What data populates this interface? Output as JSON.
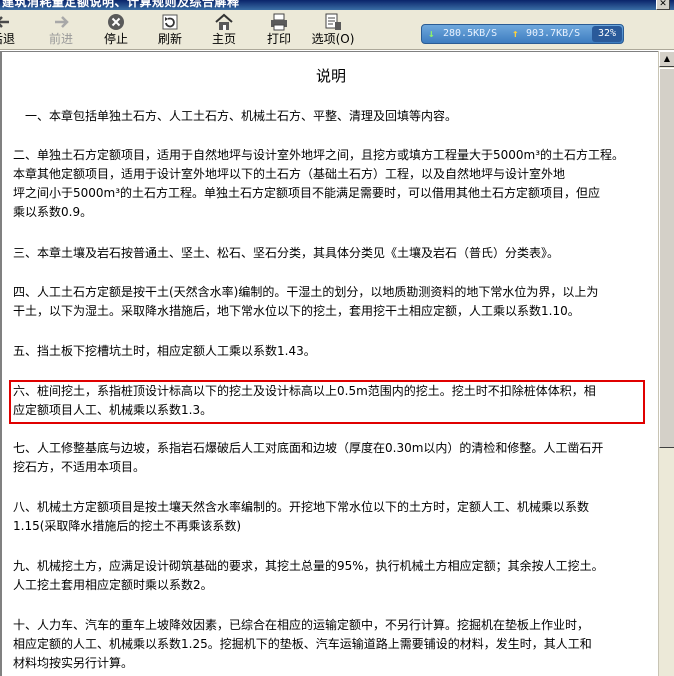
{
  "window": {
    "title": "建筑消耗量定额说明、计算规则及综合解释"
  },
  "toolbar": {
    "buttons": [
      {
        "id": "back",
        "label": "后退",
        "icon": "back-arrow-icon"
      },
      {
        "id": "forward",
        "label": "前进",
        "icon": "forward-arrow-icon"
      },
      {
        "id": "stop",
        "label": "停止",
        "icon": "stop-icon"
      },
      {
        "id": "refresh",
        "label": "刷新",
        "icon": "refresh-icon"
      },
      {
        "id": "home",
        "label": "主页",
        "icon": "home-icon"
      },
      {
        "id": "print",
        "label": "打印",
        "icon": "print-icon"
      },
      {
        "id": "options",
        "label": "选项(O)",
        "icon": "options-icon"
      }
    ]
  },
  "network": {
    "download": "280.5KB/S",
    "upload": "903.7KB/S",
    "percent": "32%",
    "colors": {
      "download_arrow": "#8ef06a",
      "upload_arrow": "#ffd23a"
    }
  },
  "document": {
    "title": "说明",
    "paragraphs": [
      {
        "lines": [
          "　一、本章包括单独土石方、人工土石方、机械土石方、平整、清理及回填等内容。"
        ]
      },
      {
        "lines": [
          "二、单独土石方定额项目，适用于自然地坪与设计室外地坪之间，且挖方或填方工程量大于5000m³的土石方工程。",
          "本章其他定额项目，适用于设计室外地坪以下的土石方（基础土石方）工程，以及自然地坪与设计室外地",
          "坪之间小于5000m³的土石方工程。单独土石方定额项目不能满足需要时，可以借用其他土石方定额项目，但应",
          "乘以系数0.9。"
        ]
      },
      {
        "lines": [
          "三、本章土壤及岩石按普通土、坚土、松石、坚石分类，其具体分类见《土壤及岩石（普氏）分类表》。"
        ]
      },
      {
        "lines": [
          "四、人工土石方定额是按干土(天然含水率)编制的。干湿土的划分，以地质勘测资料的地下常水位为界，以上为",
          "干土，以下为湿土。采取降水措施后，地下常水位以下的挖土，套用挖干土相应定额，人工乘以系数1.10。"
        ]
      },
      {
        "lines": [
          "五、挡土板下挖槽坑土时，相应定额人工乘以系数1.43。"
        ]
      },
      {
        "lines": [
          "六、桩间挖土，系指桩顶设计标高以下的挖土及设计标高以上0.5m范围内的挖土。挖土时不扣除桩体体积，相",
          "应定额项目人工、机械乘以系数1.3。"
        ]
      },
      {
        "lines": [
          "七、人工修整基底与边坡，系指岩石爆破后人工对底面和边坡（厚度在0.30m以内）的清检和修整。人工凿石开",
          "挖石方，不适用本项目。"
        ]
      },
      {
        "lines": [
          "八、机械土方定额项目是按土壤天然含水率编制的。开挖地下常水位以下的土方时，定额人工、机械乘以系数",
          "1.15(采取降水措施后的挖土不再乘该系数)"
        ]
      },
      {
        "lines": [
          "九、机械挖土方，应满足设计砌筑基础的要求，其挖土总量的95%，执行机械土方相应定额；其余按人工挖土。",
          "人工挖土套用相应定额时乘以系数2。"
        ]
      },
      {
        "lines": [
          "十、人力车、汽车的重车上坡降效因素，已综合在相应的运输定额中，不另行计算。挖掘机在垫板上作业时，",
          "相应定额的人工、机械乘以系数1.25。挖掘机下的垫板、汽车运输道路上需要铺设的材料，发生时，其人工和",
          "材料均按实另行计算。"
        ]
      }
    ]
  },
  "annotation": {
    "highlight_color": "#e00000"
  }
}
